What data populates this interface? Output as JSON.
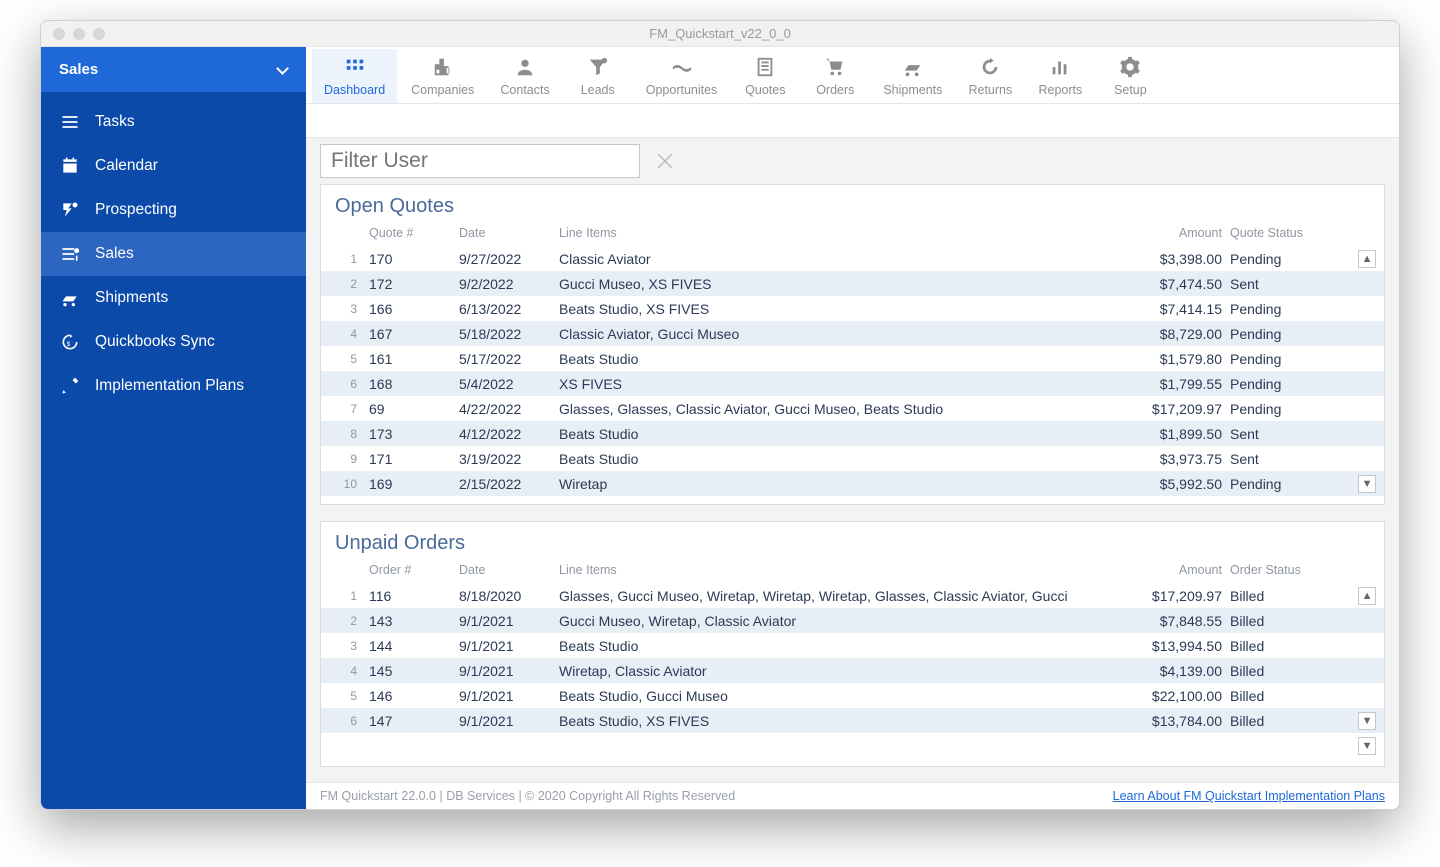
{
  "window": {
    "title": "FM_Quickstart_v22_0_0"
  },
  "sidebar": {
    "head": "Sales",
    "items": [
      {
        "label": "Tasks"
      },
      {
        "label": "Calendar"
      },
      {
        "label": "Prospecting"
      },
      {
        "label": "Sales",
        "selected": true
      },
      {
        "label": "Shipments"
      },
      {
        "label": "Quickbooks Sync"
      },
      {
        "label": "Implementation Plans"
      }
    ]
  },
  "toolbar": {
    "items": [
      {
        "label": "Dashboard",
        "active": true
      },
      {
        "label": "Companies"
      },
      {
        "label": "Contacts"
      },
      {
        "label": "Leads"
      },
      {
        "label": "Opportunites"
      },
      {
        "label": "Quotes"
      },
      {
        "label": "Orders"
      },
      {
        "label": "Shipments"
      },
      {
        "label": "Returns"
      },
      {
        "label": "Reports"
      },
      {
        "label": "Setup"
      }
    ]
  },
  "filter": {
    "placeholder": "Filter User"
  },
  "openQuotes": {
    "title": "Open Quotes",
    "headers": {
      "id": "Quote #",
      "date": "Date",
      "items": "Line Items",
      "amount": "Amount",
      "status": "Quote Status"
    },
    "rows": [
      {
        "n": "1",
        "id": "170",
        "date": "9/27/2022",
        "items": "Classic Aviator",
        "amount": "$3,398.00",
        "status": "Pending"
      },
      {
        "n": "2",
        "id": "172",
        "date": "9/2/2022",
        "items": "Gucci Museo, XS FIVES",
        "amount": "$7,474.50",
        "status": "Sent"
      },
      {
        "n": "3",
        "id": "166",
        "date": "6/13/2022",
        "items": "Beats Studio, XS FIVES",
        "amount": "$7,414.15",
        "status": "Pending"
      },
      {
        "n": "4",
        "id": "167",
        "date": "5/18/2022",
        "items": "Classic Aviator, Gucci Museo",
        "amount": "$8,729.00",
        "status": "Pending"
      },
      {
        "n": "5",
        "id": "161",
        "date": "5/17/2022",
        "items": "Beats Studio",
        "amount": "$1,579.80",
        "status": "Pending"
      },
      {
        "n": "6",
        "id": "168",
        "date": "5/4/2022",
        "items": "XS FIVES",
        "amount": "$1,799.55",
        "status": "Pending"
      },
      {
        "n": "7",
        "id": "69",
        "date": "4/22/2022",
        "items": "Glasses, Glasses, Classic Aviator, Gucci Museo, Beats Studio",
        "amount": "$17,209.97",
        "status": "Pending"
      },
      {
        "n": "8",
        "id": "173",
        "date": "4/12/2022",
        "items": "Beats Studio",
        "amount": "$1,899.50",
        "status": "Sent"
      },
      {
        "n": "9",
        "id": "171",
        "date": "3/19/2022",
        "items": "Beats Studio",
        "amount": "$3,973.75",
        "status": "Sent"
      },
      {
        "n": "10",
        "id": "169",
        "date": "2/15/2022",
        "items": "Wiretap",
        "amount": "$5,992.50",
        "status": "Pending"
      }
    ]
  },
  "unpaidOrders": {
    "title": "Unpaid Orders",
    "headers": {
      "id": "Order #",
      "date": "Date",
      "items": "Line Items",
      "amount": "Amount",
      "status": "Order Status"
    },
    "rows": [
      {
        "n": "1",
        "id": "116",
        "date": "8/18/2020",
        "items": "Glasses, Gucci Museo, Wiretap, Wiretap, Wiretap, Glasses, Classic Aviator, Gucci",
        "amount": "$17,209.97",
        "status": "Billed"
      },
      {
        "n": "2",
        "id": "143",
        "date": "9/1/2021",
        "items": "Gucci Museo, Wiretap, Classic Aviator",
        "amount": "$7,848.55",
        "status": "Billed"
      },
      {
        "n": "3",
        "id": "144",
        "date": "9/1/2021",
        "items": "Beats Studio",
        "amount": "$13,994.50",
        "status": "Billed"
      },
      {
        "n": "4",
        "id": "145",
        "date": "9/1/2021",
        "items": "Wiretap, Classic Aviator",
        "amount": "$4,139.00",
        "status": "Billed"
      },
      {
        "n": "5",
        "id": "146",
        "date": "9/1/2021",
        "items": "Beats Studio, Gucci Museo",
        "amount": "$22,100.00",
        "status": "Billed"
      },
      {
        "n": "6",
        "id": "147",
        "date": "9/1/2021",
        "items": "Beats Studio, XS FIVES",
        "amount": "$13,784.00",
        "status": "Billed"
      }
    ]
  },
  "footer": {
    "left": "FM Quickstart 22.0.0  | DB Services | © 2020 Copyright All Rights Reserved",
    "link": "Learn About FM Quickstart Implementation Plans"
  }
}
